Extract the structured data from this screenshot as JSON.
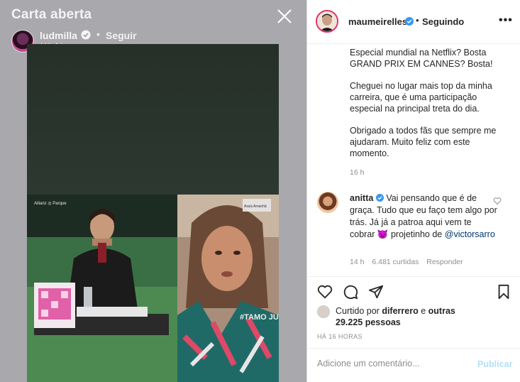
{
  "story": {
    "title": "Carta aberta",
    "username": "ludmilla",
    "separator": "•",
    "follow_label": "Seguir",
    "time": "Há 4 horas",
    "overlay_top_left": "Allianz ◎ Parque",
    "overlay_top_right": "Assis Amanhã",
    "overlay_hashtag": "#TAMO JUNTO"
  },
  "post": {
    "username": "maumeirelles",
    "separator": "•",
    "following_label": "Seguindo",
    "more_label": "•••",
    "caption": {
      "p1": "Especial mundial na Netflix? Bosta GRAND PRIX EM CANNES? Bosta!",
      "p2": "Cheguei no lugar mais top da minha carreira, que é uma participação especial na principal treta do dia.",
      "p3": "Obrigado a todos fãs que sempre me ajudaram. Muito feliz com este momento."
    },
    "caption_time": "16 h",
    "comment": {
      "username": "anitta",
      "text_before": "Vai pensando que é de graça. Tudo que eu faço tem algo por trás. Já já a patroa aqui vem te cobrar",
      "emoji": "👿",
      "text_after": "projetinho de",
      "mention": "@victorsarro",
      "time": "14 h",
      "likes": "6.481 curtidas",
      "reply_label": "Responder"
    },
    "likes": {
      "prefix": "Curtido por",
      "user": "diferrero",
      "middle": "e",
      "others": "outras 29.225 pessoas"
    },
    "date": "HÁ 16 HORAS",
    "comment_input": {
      "placeholder": "Adicione um comentário...",
      "value": ""
    },
    "publish_label": "Publicar"
  },
  "colors": {
    "story_bg": "#a8a8ad",
    "verified": "#3897f0",
    "mention": "#00376b",
    "publish_disabled": "#b2dffc"
  }
}
